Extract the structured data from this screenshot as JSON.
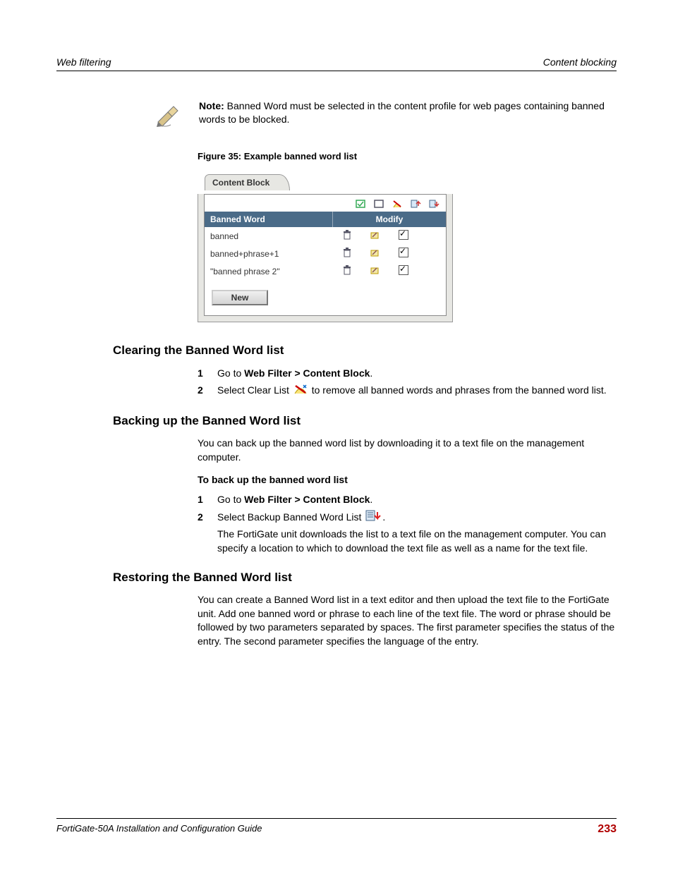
{
  "header": {
    "left": "Web filtering",
    "right": "Content blocking"
  },
  "note": {
    "label": "Note:",
    "text": " Banned Word must be selected in the content profile for web pages containing banned words to be blocked."
  },
  "figure": {
    "caption": "Figure 35: Example banned word list",
    "tab_label": "Content Block",
    "th_word": "Banned Word",
    "th_modify": "Modify",
    "rows": [
      {
        "word": "banned"
      },
      {
        "word": "banned+phrase+1"
      },
      {
        "word": "\"banned phrase 2\""
      }
    ],
    "new_button": "New",
    "toolbar_icons": [
      "check-all-icon",
      "uncheck-all-icon",
      "clear-list-icon",
      "upload-icon",
      "download-icon"
    ]
  },
  "sections": {
    "clearing": {
      "title": "Clearing the Banned Word list",
      "step1_a": "Go to ",
      "step1_b": "Web Filter > Content Block",
      "step1_c": ".",
      "step2_a": "Select Clear List ",
      "step2_b": " to remove all banned words and phrases from the banned word list."
    },
    "backing": {
      "title": "Backing up the Banned Word list",
      "intro": "You can back up the banned word list by downloading it to a text file on the management computer.",
      "proc_heading": "To back up the banned word list",
      "step1_a": "Go to ",
      "step1_b": "Web Filter > Content Block",
      "step1_c": ".",
      "step2_a": "Select Backup Banned Word List ",
      "step2_b": ".",
      "step2_after": "The FortiGate unit downloads the list to a text file on the management computer. You can specify a location to which to download the text file as well as a name for the text file."
    },
    "restoring": {
      "title": "Restoring the Banned Word list",
      "body": "You can create a Banned Word list in a text editor and then upload the text file to the FortiGate unit. Add one banned word or phrase to each line of the text file. The word or phrase should be followed by two parameters separated by spaces. The first parameter specifies the status of the entry. The second parameter specifies the language of the entry."
    }
  },
  "footer": {
    "guide": "FortiGate-50A Installation and Configuration Guide",
    "page": "233"
  }
}
